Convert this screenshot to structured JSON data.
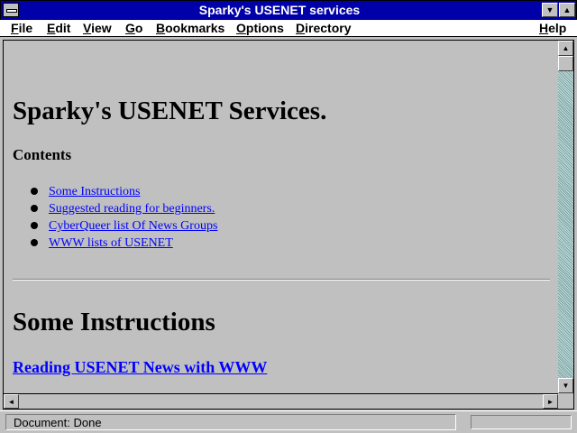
{
  "window": {
    "title": "Sparky's USENET services",
    "minimize_glyph": "▼",
    "maximize_glyph": "▲"
  },
  "menu": [
    {
      "first": "F",
      "rest": "ile"
    },
    {
      "first": "E",
      "rest": "dit"
    },
    {
      "first": "V",
      "rest": "iew"
    },
    {
      "first": "G",
      "rest": "o"
    },
    {
      "first": "B",
      "rest": "ookmarks"
    },
    {
      "first": "O",
      "rest": "ptions"
    },
    {
      "first": "D",
      "rest": "irectory"
    },
    {
      "first": "H",
      "rest": "elp"
    }
  ],
  "page": {
    "heading": "Sparky's USENET Services.",
    "contents_heading": "Contents",
    "links": [
      "Some Instructions",
      "Suggested reading for beginners.",
      "CyberQueer list Of News Groups",
      "WWW lists of USENET"
    ],
    "section_heading": "Some Instructions",
    "section_link": "Reading USENET News with WWW"
  },
  "scroll": {
    "up": "▲",
    "down": "▼",
    "left": "◄",
    "right": "►"
  },
  "status": {
    "text": "Document: Done"
  }
}
